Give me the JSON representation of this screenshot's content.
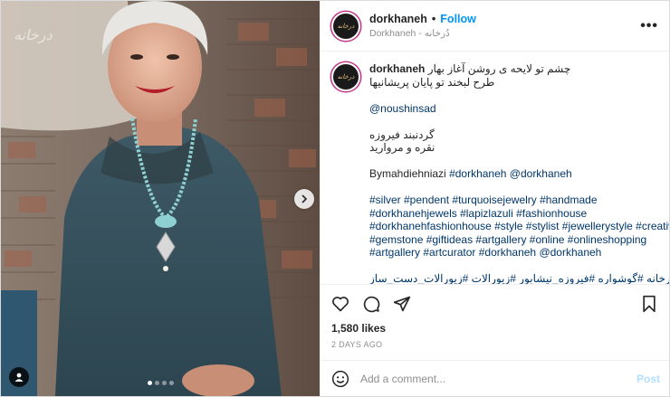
{
  "photo": {
    "watermark": "درخانه",
    "carousel_dots": 4,
    "active_dot": 0,
    "next_icon": "chevron-right-icon",
    "tag_icon": "user-tag-icon"
  },
  "header": {
    "avatar_text": "درخانه",
    "username": "dorkhaneh",
    "separator": "•",
    "follow_label": "Follow",
    "subtitle": "Dorkhaneh - دُرخانه",
    "more_icon": "more-horizontal-icon",
    "more_label": "•••"
  },
  "caption": {
    "username": "dorkhaneh",
    "line1": "چشم تو لایحه ی روشن آغاز بهار",
    "line2": "طرح لبخند تو پایان پریشانیها",
    "mention": "@noushinsad",
    "persian1": "گردنبند فیروزه",
    "persian2": "نقره و مروارید",
    "by_prefix": "Bymahdiehniazi ",
    "by_tags": "#dorkhaneh @dorkhaneh",
    "hashtags": [
      "#silver #pendent #turquoisejewelry #handmade",
      "#dorkhanehjewels #lapizlazuli #fashionhouse",
      "#dorkhanehfashionhouse #style #stylist #jewellerystyle #creative",
      "#gemstone #giftideas #artgallery #online #onlineshopping",
      "#artgallery #artcurator #dorkhaneh @dorkhaneh"
    ],
    "persian_tags": "دُرخانه #گوشواره #فیروزه_نیشابور #زیورالات #زیورالات_دست_ساز#"
  },
  "actions": {
    "like_icon": "heart-icon",
    "comment_icon": "comment-icon",
    "share_icon": "share-icon",
    "save_icon": "bookmark-icon"
  },
  "likes": "1,580 likes",
  "date": "2 DAYS AGO",
  "comment_box": {
    "emoji_icon": "emoji-icon",
    "placeholder": "Add a comment...",
    "post_label": "Post",
    "post_color": "#b2dffc"
  },
  "colors": {
    "accent": "#0095f6",
    "link": "#00376b",
    "muted": "#8e8e8e",
    "border": "#dbdbdb"
  }
}
